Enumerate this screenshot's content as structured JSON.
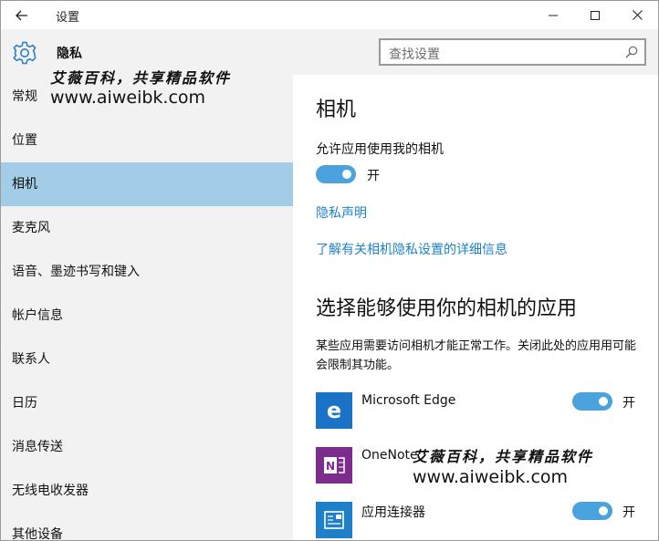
{
  "window": {
    "title": "设置",
    "back_icon": "arrow-left-icon",
    "controls": [
      "minimize-icon",
      "maximize-icon",
      "close-icon"
    ]
  },
  "header": {
    "icon": "gear-icon",
    "title": "隐私",
    "search": {
      "placeholder": "查找设置",
      "icon": "search-icon"
    }
  },
  "sidebar": {
    "items": [
      {
        "label": "常规",
        "selected": false
      },
      {
        "label": "位置",
        "selected": false
      },
      {
        "label": "相机",
        "selected": true
      },
      {
        "label": "麦克风",
        "selected": false
      },
      {
        "label": "语音、墨迹书写和键入",
        "selected": false
      },
      {
        "label": "帐户信息",
        "selected": false
      },
      {
        "label": "联系人",
        "selected": false
      },
      {
        "label": "日历",
        "selected": false
      },
      {
        "label": "消息传送",
        "selected": false
      },
      {
        "label": "无线电收发器",
        "selected": false
      },
      {
        "label": "其他设备",
        "selected": false
      }
    ]
  },
  "main": {
    "title": "相机",
    "allow_label": "允许应用使用我的相机",
    "allow_toggle": {
      "state": "开",
      "on": true
    },
    "privacy_link": "隐私声明",
    "learn_more_link": "了解有关相机隐私设置的详细信息",
    "apps_title": "选择能够使用你的相机的应用",
    "apps_description": "某些应用需要访问相机才能正常工作。关闭此处的应用用可能会限制其功能。",
    "apps": [
      {
        "name": "Microsoft Edge",
        "icon": "edge-icon",
        "toggle": "开",
        "on": true
      },
      {
        "name": "OneNote",
        "icon": "onenote-icon",
        "toggle": "",
        "on": null
      },
      {
        "name": "应用连接器",
        "icon": "app-connector-icon",
        "toggle": "开",
        "on": true
      }
    ]
  },
  "watermark": {
    "text_cn": "艾薇百科，共享精品软件",
    "url": "www.aiweibk.com"
  },
  "colors": {
    "accent": "#4aa3dc",
    "selected_bg": "#a3cde6",
    "link": "#1e82c8",
    "sidebar_bg": "#f2f2f2",
    "edge_blue": "#1a73c6",
    "onenote_purple": "#7b2c8c"
  }
}
